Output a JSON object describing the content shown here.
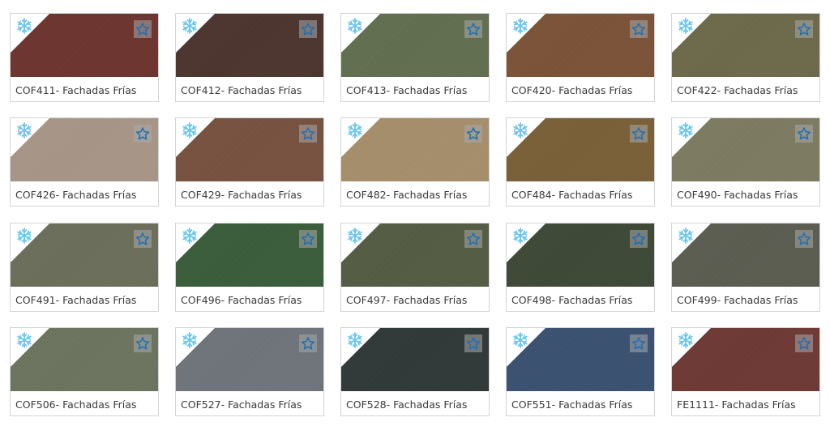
{
  "products": [
    {
      "code_label": "COF411- Fachadas Frías",
      "color": "#6e352f",
      "icon": "snowflake-icon",
      "favorite_icon": "star-outline-icon"
    },
    {
      "code_label": "COF412- Fachadas Frías",
      "color": "#4d3630",
      "icon": "snowflake-icon",
      "favorite_icon": "star-outline-icon"
    },
    {
      "code_label": "COF413- Fachadas Frías",
      "color": "#627051",
      "icon": "snowflake-icon",
      "favorite_icon": "star-outline-icon"
    },
    {
      "code_label": "COF420- Fachadas Frías",
      "color": "#7c5438",
      "icon": "snowflake-icon",
      "favorite_icon": "star-outline-icon"
    },
    {
      "code_label": "COF422- Fachadas Frías",
      "color": "#6d6b4b",
      "icon": "snowflake-icon",
      "favorite_icon": "star-outline-icon"
    },
    {
      "code_label": "COF426- Fachadas Frías",
      "color": "#a99888",
      "icon": "snowflake-icon",
      "favorite_icon": "star-outline-icon"
    },
    {
      "code_label": "COF429- Fachadas Frías",
      "color": "#795340",
      "icon": "snowflake-icon",
      "favorite_icon": "star-outline-icon"
    },
    {
      "code_label": "COF482- Fachadas Frías",
      "color": "#a8906c",
      "icon": "snowflake-icon",
      "favorite_icon": "star-outline-icon"
    },
    {
      "code_label": "COF484- Fachadas Frías",
      "color": "#7b6139",
      "icon": "snowflake-icon",
      "favorite_icon": "star-outline-icon"
    },
    {
      "code_label": "COF490- Fachadas Frías",
      "color": "#7f7c63",
      "icon": "snowflake-icon",
      "favorite_icon": "star-outline-icon"
    },
    {
      "code_label": "COF491- Fachadas Frías",
      "color": "#6d705d",
      "icon": "snowflake-icon",
      "favorite_icon": "star-outline-icon"
    },
    {
      "code_label": "COF496- Fachadas Frías",
      "color": "#3c5e3c",
      "icon": "snowflake-icon",
      "favorite_icon": "star-outline-icon"
    },
    {
      "code_label": "COF497- Fachadas Frías",
      "color": "#555d44",
      "icon": "snowflake-icon",
      "favorite_icon": "star-outline-icon"
    },
    {
      "code_label": "COF498- Fachadas Frías",
      "color": "#3e4a37",
      "icon": "snowflake-icon",
      "favorite_icon": "star-outline-icon"
    },
    {
      "code_label": "COF499- Fachadas Frías",
      "color": "#5c5e52",
      "icon": "snowflake-icon",
      "favorite_icon": "star-outline-icon"
    },
    {
      "code_label": "COF506- Fachadas Frías",
      "color": "#6d7660",
      "icon": "snowflake-icon",
      "favorite_icon": "star-outline-icon"
    },
    {
      "code_label": "COF527- Fachadas Frías",
      "color": "#6f767b",
      "icon": "snowflake-icon",
      "favorite_icon": "star-outline-icon"
    },
    {
      "code_label": "COF528- Fachadas Frías",
      "color": "#313939",
      "icon": "snowflake-icon",
      "favorite_icon": "star-outline-icon"
    },
    {
      "code_label": "COF551- Fachadas Frías",
      "color": "#3b5271",
      "icon": "snowflake-icon",
      "favorite_icon": "star-outline-icon"
    },
    {
      "code_label": "FE1111- Fachadas Frías",
      "color": "#703a36",
      "icon": "snowflake-icon",
      "favorite_icon": "star-outline-icon"
    }
  ],
  "colors": {
    "snowflake": "#6cc6ec",
    "star": "#1f6fb4",
    "card_border": "#d4d4d4",
    "label_text": "#3a3a3a"
  }
}
